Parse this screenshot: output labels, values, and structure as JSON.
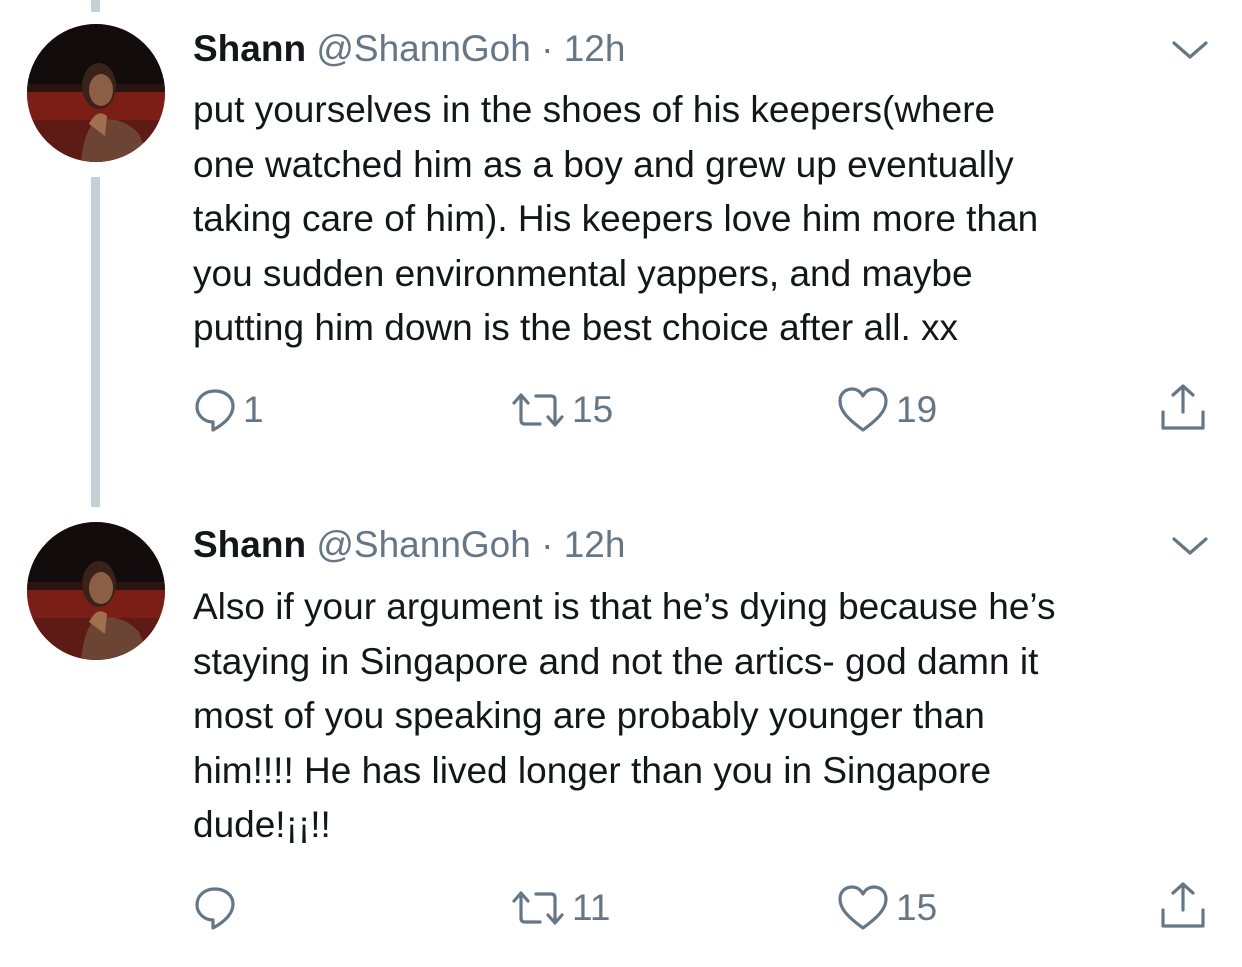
{
  "tweets": [
    {
      "name": "Shann",
      "handle": "@ShannGoh",
      "separator": "·",
      "time": "12h",
      "lines": [
        "put yourselves in the shoes of his keepers(where",
        "one watched him as a boy and grew up eventually",
        "taking care of him). His keepers love him more than",
        "you sudden environmental yappers, and maybe",
        "putting him down is the best choice after all. xx"
      ],
      "actions": {
        "replies": "1",
        "retweets": "15",
        "likes": "19"
      }
    },
    {
      "name": "Shann",
      "handle": "@ShannGoh",
      "separator": "·",
      "time": "12h",
      "lines": [
        "Also if your argument is that he’s dying because he’s",
        "staying in Singapore and not the artics- god damn it",
        "most of you speaking are probably younger than",
        "him!!!! He has lived longer than you in Singapore",
        "dude!¡¡!!"
      ],
      "actions": {
        "replies": "",
        "retweets": "11",
        "likes": "15"
      }
    }
  ],
  "icons": {
    "avatar": "profile-photo",
    "menu": "chevron-down-icon",
    "reply": "reply-icon",
    "retweet": "retweet-icon",
    "like": "heart-icon",
    "share": "share-icon"
  },
  "colors": {
    "text": "#14171a",
    "secondary": "#657786",
    "thread_line": "#c4cfd6"
  }
}
